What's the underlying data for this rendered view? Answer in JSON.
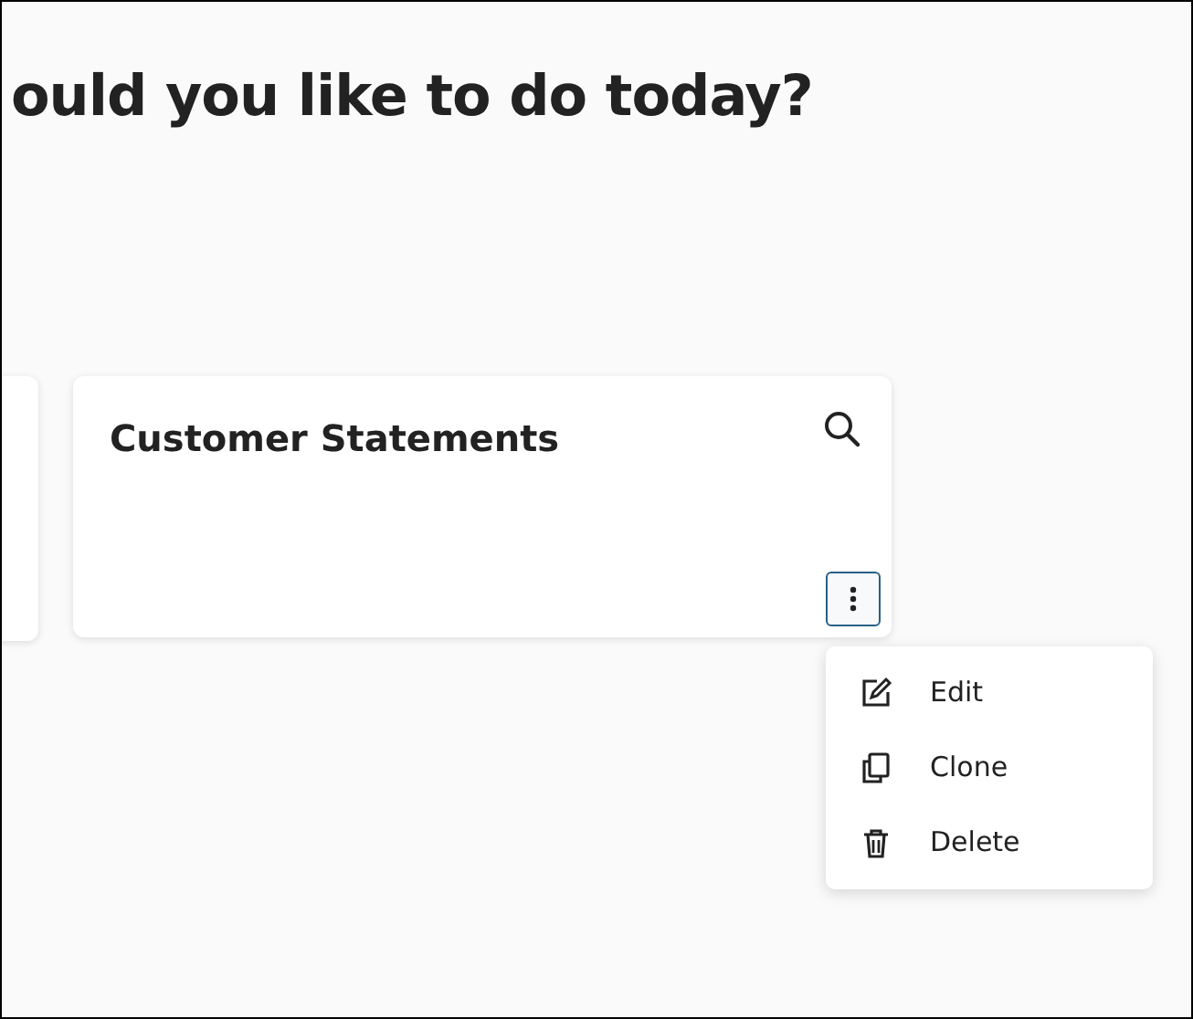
{
  "heading": "ould you like to do today?",
  "card": {
    "title": "Customer Statements",
    "more_button": {
      "expanded": true
    }
  },
  "menu": [
    {
      "kind": "edit",
      "label": "Edit"
    },
    {
      "kind": "clone",
      "label": "Clone"
    },
    {
      "kind": "delete",
      "label": "Delete"
    }
  ]
}
